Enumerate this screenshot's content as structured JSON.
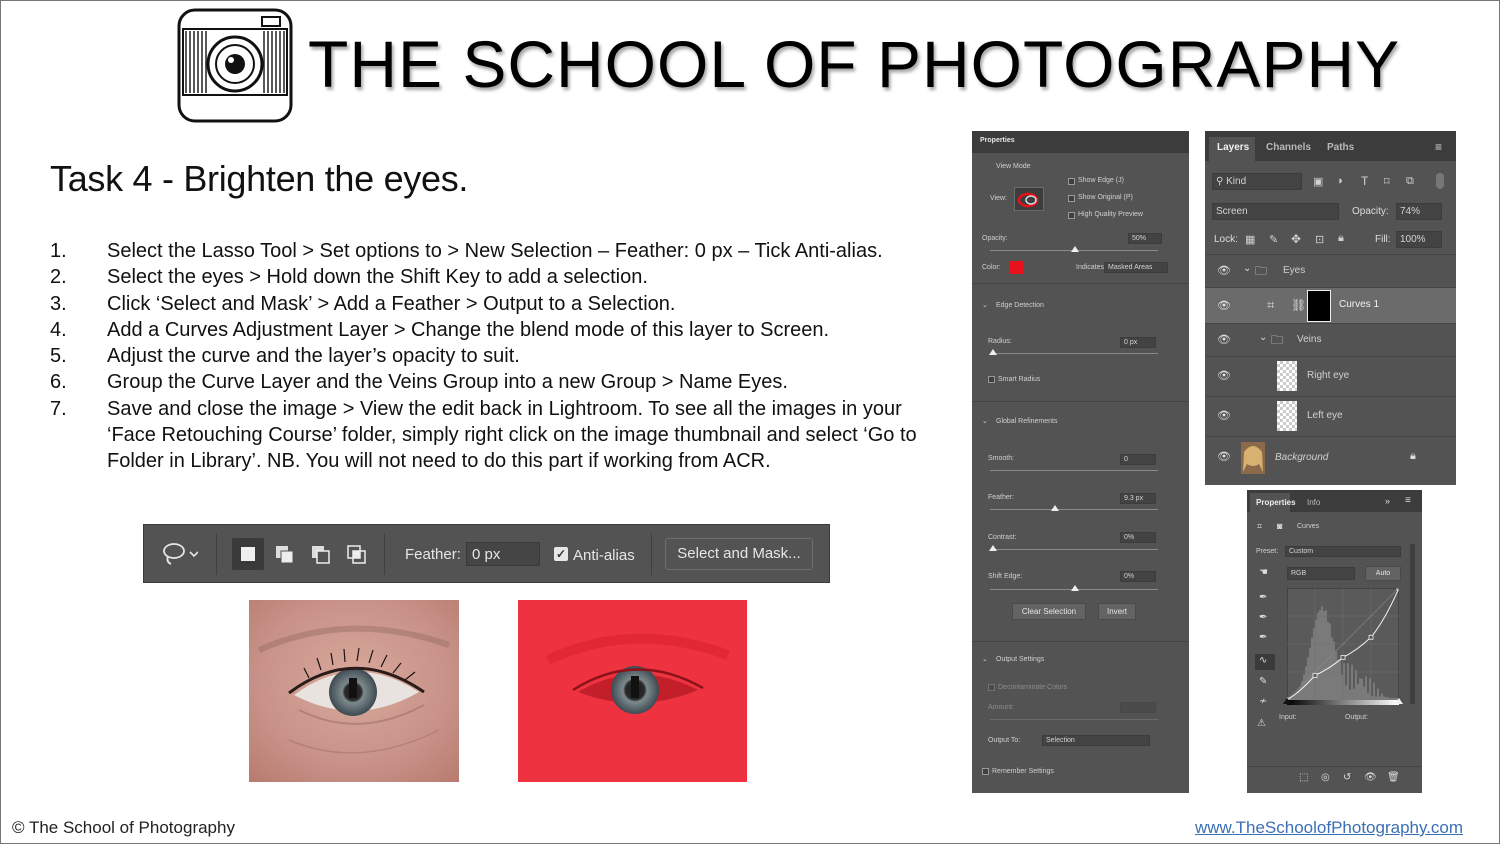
{
  "header": {
    "brand": "THE SCHOOL OF PHOTOGRAPHY",
    "logo_icon": "camera-sketch-icon"
  },
  "task": {
    "title": "Task 4 - Brighten the eyes.",
    "steps": [
      {
        "num": "1.",
        "text": "Select the Lasso Tool > Set options to > New Selection – Feather: 0 px – Tick Anti-alias."
      },
      {
        "num": "2.",
        "text": "Select the eyes > Hold down the Shift Key to add a selection."
      },
      {
        "num": "3.",
        "text": "Click ‘Select and Mask’ > Add a Feather > Output to a Selection."
      },
      {
        "num": "4.",
        "text": "Add a Curves Adjustment Layer > Change the blend mode of this layer to Screen."
      },
      {
        "num": "5.",
        "text": "Adjust the curve and the layer’s opacity to suit."
      },
      {
        "num": "6.",
        "text": "Group the Curve Layer and the Veins Group into a new Group > Name Eyes."
      },
      {
        "num": "7.",
        "text": "Save and close the image > View the edit back in Lightroom. To see all the images in your ‘Face Retouching Course’ folder, simply right click on the image thumbnail and select ‘Go to Folder in Library’. NB. You will not need to do this part if working from ACR."
      }
    ]
  },
  "options_bar": {
    "feather_label": "Feather:",
    "feather_value": "0 px",
    "antialias_label": "Anti-alias",
    "antialias_checked": true,
    "select_mask_label": "Select and Mask..."
  },
  "select_mask": {
    "title": "Properties",
    "view_mode": "View Mode",
    "view_label": "View:",
    "show_edge": "Show Edge (J)",
    "show_original": "Show Original (P)",
    "hq_preview": "High Quality Preview",
    "opacity_label": "Opacity:",
    "opacity_value": "50%",
    "color_label": "Color:",
    "overlay_color": "#e8101a",
    "indicates_label": "Indicates:",
    "indicates_value": "Masked Areas",
    "edge_detection": "Edge Detection",
    "radius_label": "Radius:",
    "radius_value": "0 px",
    "smart_radius": "Smart Radius",
    "global_refinements": "Global Refinements",
    "smooth_label": "Smooth:",
    "smooth_value": "0",
    "feather_label": "Feather:",
    "feather_value": "9.3 px",
    "contrast_label": "Contrast:",
    "contrast_value": "0%",
    "shift_label": "Shift Edge:",
    "shift_value": "0%",
    "clear_selection": "Clear Selection",
    "invert": "Invert",
    "output_settings": "Output Settings",
    "decontaminate": "Decontaminate Colors",
    "amount_label": "Amount:",
    "output_to_label": "Output To:",
    "output_to_value": "Selection",
    "remember": "Remember Settings"
  },
  "layers": {
    "tabs": [
      "Layers",
      "Channels",
      "Paths"
    ],
    "kind": "Kind",
    "blend_mode": "Screen",
    "opacity_label": "Opacity:",
    "opacity_value": "74%",
    "lock_label": "Lock:",
    "fill_label": "Fill:",
    "fill_value": "100%",
    "items": [
      {
        "name": "Eyes"
      },
      {
        "name": "Curves 1"
      },
      {
        "name": "Veins"
      },
      {
        "name": "Right eye"
      },
      {
        "name": "Left eye"
      },
      {
        "name": "Background"
      }
    ]
  },
  "curves": {
    "tabs": [
      "Properties",
      "Info"
    ],
    "title": "Curves",
    "preset_label": "Preset:",
    "preset_value": "Custom",
    "channel": "RGB",
    "auto_label": "Auto",
    "input_label": "Input:",
    "output_label": "Output:",
    "points": [
      [
        0,
        0
      ],
      [
        0.25,
        0.22
      ],
      [
        0.5,
        0.38
      ],
      [
        0.75,
        0.56
      ],
      [
        1,
        1
      ]
    ]
  },
  "footer": {
    "copyright": "© The School of Photography",
    "url": "www.TheSchoolofPhotography.com"
  }
}
